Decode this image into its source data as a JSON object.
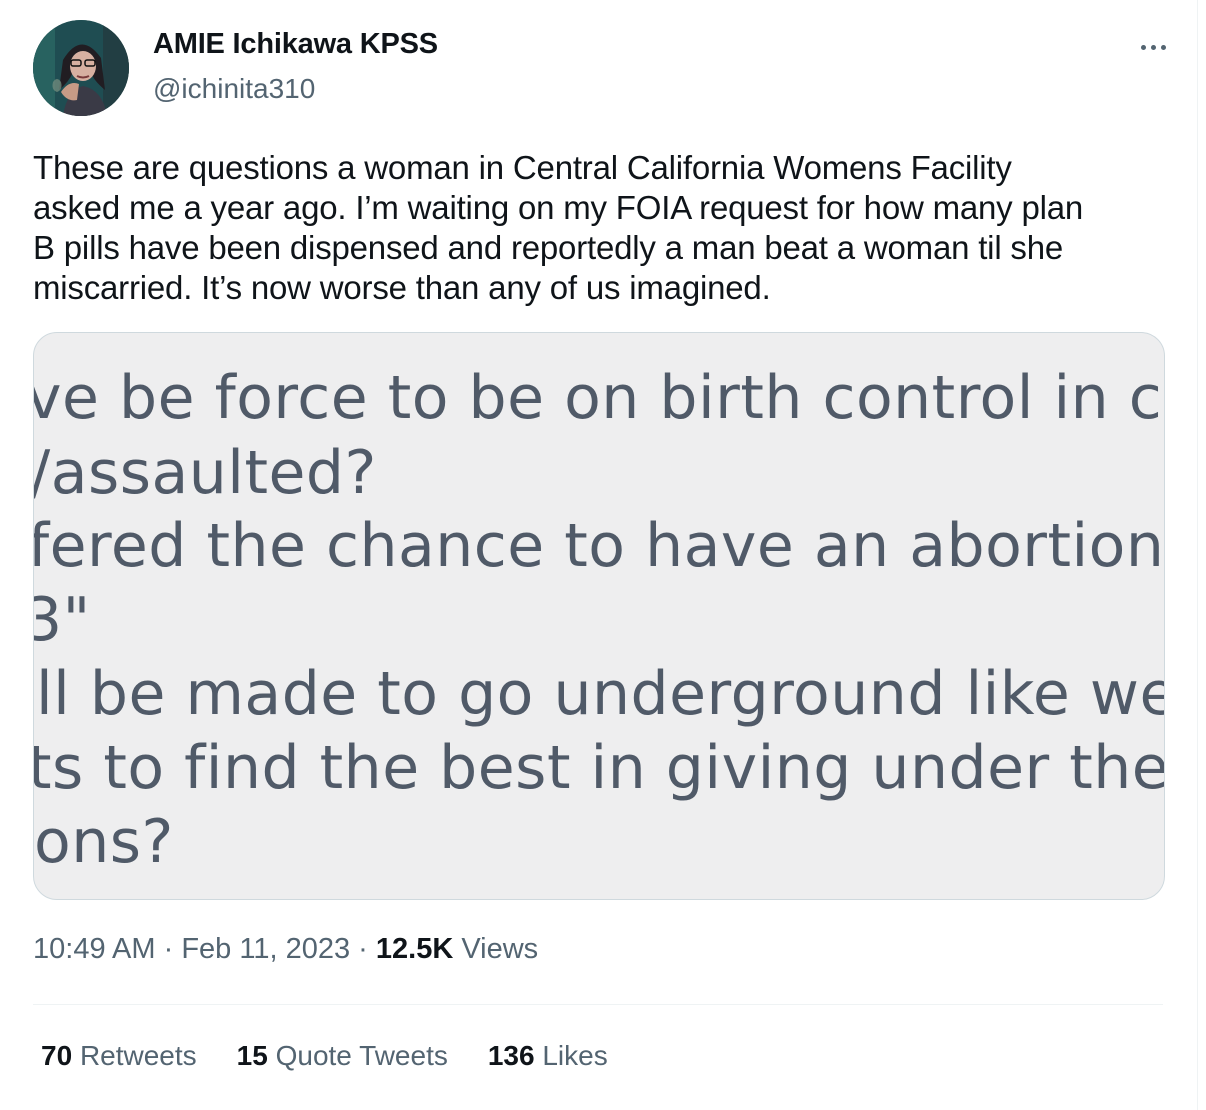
{
  "author": {
    "display_name": "AMIE Ichikawa KPSS",
    "handle": "@ichinita310"
  },
  "tweet": {
    "text": "These are questions a woman in Central California Womens Facility\nasked me a year ago. I’m waiting on my FOIA request for how many plan\nB pills have been dispensed and reportedly a man beat a woman til she\nmiscarried. It’s now worse than any of us imagined.",
    "time": "10:49 AM",
    "date": "Feb 11, 2023",
    "separator": "·",
    "views_count": "12.5K",
    "views_label": "Views"
  },
  "media": {
    "lines": [
      "ve be force to be on birth control in case",
      "/assaulted?",
      "fered the chance to have an abortion or g",
      "3\"",
      "ll be made to go underground like we do",
      "ts to find the best in giving under the tab",
      "ons?"
    ]
  },
  "stats": {
    "retweets_count": "70",
    "retweets_label": "Retweets",
    "quotes_count": "15",
    "quotes_label": "Quote Tweets",
    "likes_count": "136",
    "likes_label": "Likes"
  },
  "icons": {
    "more": "more-options-icon"
  }
}
